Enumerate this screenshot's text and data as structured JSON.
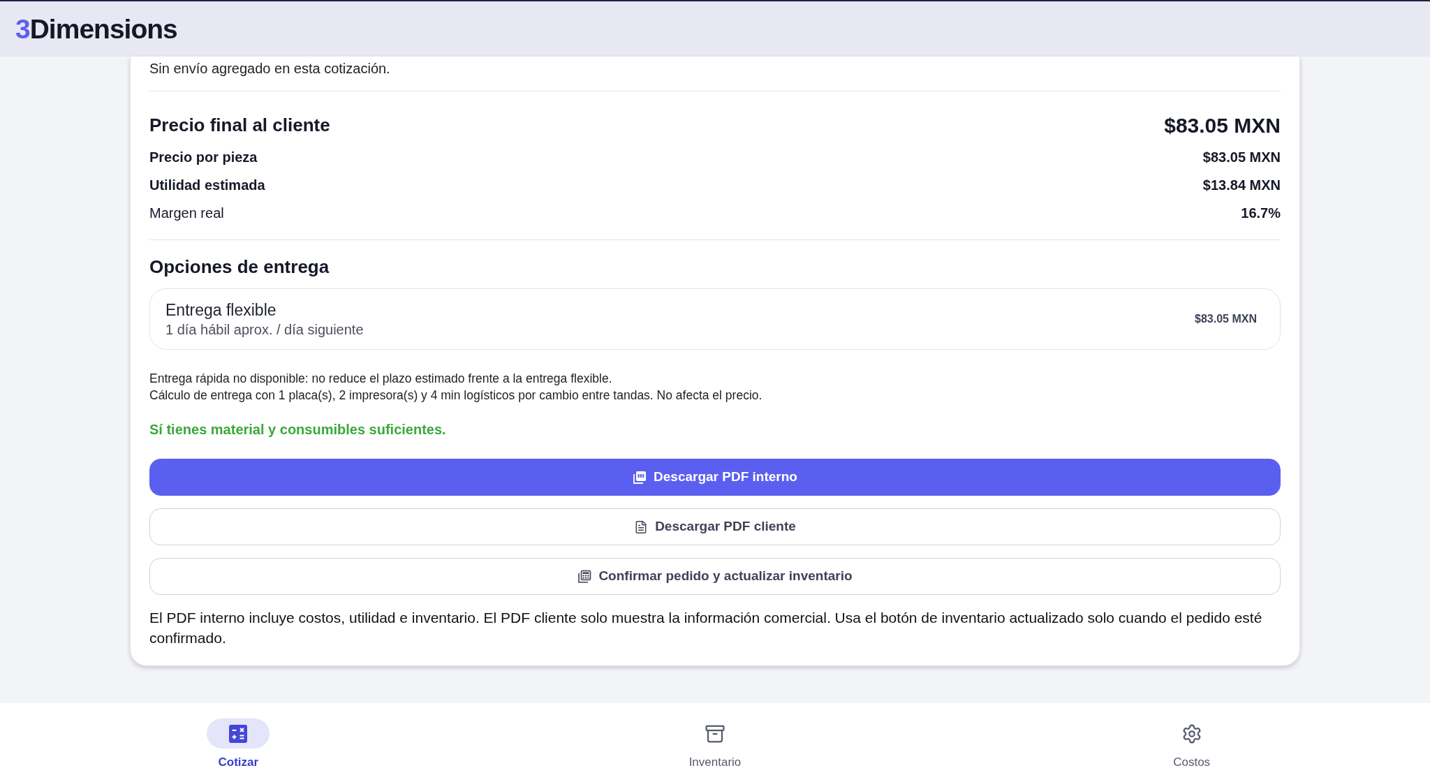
{
  "header": {
    "logo": {
      "accent": "3",
      "text": "Dimensions"
    }
  },
  "quote": {
    "shipping_note": "Sin envío agregado en esta cotización.",
    "summary": {
      "title": "Precio final al cliente",
      "total": "$83.05 MXN",
      "rows": [
        {
          "label": "Precio por pieza",
          "value": "$83.05 MXN",
          "bold": true
        },
        {
          "label": "Utilidad estimada",
          "value": "$13.84 MXN",
          "bold": true
        },
        {
          "label": "Margen real",
          "value": "16.7%",
          "bold": false
        }
      ]
    },
    "delivery": {
      "title": "Opciones de entrega",
      "options": [
        {
          "name": "Entrega flexible",
          "detail": "1 día hábil aprox. / día siguiente",
          "price": "$83.05 MXN"
        }
      ],
      "notes": [
        "Entrega rápida no disponible: no reduce el plazo estimado frente a la entrega flexible.",
        "Cálculo de entrega con 1 placa(s), 2 impresora(s) y 4 min logísticos por cambio entre tandas. No afecta el precio."
      ]
    },
    "stock_status": {
      "text": "Sí tienes material y consumibles suficientes.",
      "sufficient": true
    },
    "actions": [
      {
        "label": "Descargar PDF interno",
        "kind": "primary"
      },
      {
        "label": "Descargar PDF cliente",
        "kind": "outline"
      },
      {
        "label": "Confirmar pedido y actualizar inventario",
        "kind": "outline"
      }
    ],
    "footnote": "El PDF interno incluye costos, utilidad e inventario. El PDF cliente solo muestra la información comercial. Usa el botón de inventario actualizado solo cuando el pedido esté confirmado."
  },
  "bottom_nav": [
    {
      "label": "Cotizar",
      "selected": true
    },
    {
      "label": "Inventario",
      "selected": false
    },
    {
      "label": "Costos",
      "selected": false
    }
  ]
}
